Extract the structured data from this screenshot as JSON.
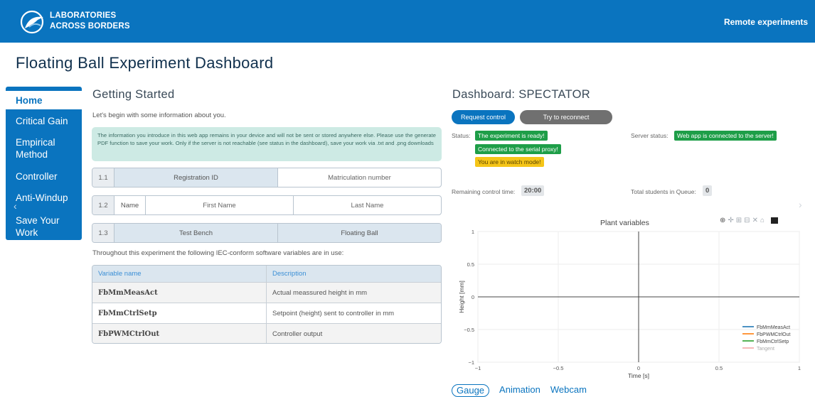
{
  "header": {
    "logo_line1": "LABORATORIES",
    "logo_line2": "ACROSS BORDERS",
    "right_link": "Remote experiments",
    "brand_color": "#0a74bf"
  },
  "page_title": "Floating Ball Experiment Dashboard",
  "sidebar": {
    "items": [
      {
        "label": "Home",
        "active": true
      },
      {
        "label": "Critical Gain"
      },
      {
        "label": "Empirical Method"
      },
      {
        "label": "Controller"
      },
      {
        "label": "Anti-Windup"
      },
      {
        "label": "Save Your Work"
      }
    ],
    "arrow_icon": "chevron-left-icon"
  },
  "getting_started": {
    "title": "Getting Started",
    "intro": "Let's begin with some information about you.",
    "info": "The information you introduce in this web app remains in your device and will not be sent or stored anywhere else. Please use the generate PDF function to save your work. Only if the server is not reachable (see status in the dashboard), save your work via .txt and .png downloads",
    "rows": [
      {
        "num": "1.1",
        "label": "Registration ID",
        "placeholder": "Matriculation number"
      },
      {
        "num": "1.2",
        "label": "Name",
        "first_placeholder": "First Name",
        "last_placeholder": "Last Name"
      },
      {
        "num": "1.3",
        "label": "Test Bench",
        "value": "Floating Ball"
      }
    ],
    "variables_intro": "Throughout this experiment the following IEC-conform software variables are in use:",
    "table": {
      "headers": [
        "Variable name",
        "Description"
      ],
      "rows": [
        [
          "FbMmMeasAct",
          "Actual meassured height in mm"
        ],
        [
          "FbMmCtrlSetp",
          "Setpoint (height) sent to controller in mm"
        ],
        [
          "FbPWMCtrlOut",
          "Controller output"
        ]
      ]
    }
  },
  "dashboard": {
    "title": "Dashboard: SPECTATOR",
    "request_btn": "Request control",
    "reconnect_btn": "Try to reconnect",
    "status_label": "Status:",
    "status_badges": [
      "The experiment is ready!",
      "Connected to the serial proxy!",
      "You are in watch mode!"
    ],
    "server_label": "Server status:",
    "server_badge": "Web app is connected to the server!",
    "remaining_label": "Remaining control time:",
    "remaining_value": "20:00",
    "queue_label": "Total students in Queue:",
    "queue_value": "0"
  },
  "chart_data": {
    "type": "line",
    "title": "Plant variables",
    "xlabel": "Time [s]",
    "ylabel": "Height [mm]",
    "xlim": [
      -1,
      1
    ],
    "ylim": [
      -1,
      1
    ],
    "xticks": [
      "−1",
      "−0.5",
      "0",
      "0.5",
      "1"
    ],
    "yticks": [
      "1",
      "0.5",
      "0",
      "−0.5",
      "−1"
    ],
    "grid": true,
    "legend_position": "bottom-right",
    "series": [
      {
        "name": "FbMmMeasAct",
        "color": "#1f77b4",
        "values": []
      },
      {
        "name": "FbPWMCtrlOut",
        "color": "#ff7f0e",
        "values": []
      },
      {
        "name": "FbMmCtrlSetp",
        "color": "#2ca02c",
        "values": []
      },
      {
        "name": "Tangent",
        "color": "#f4a6a6",
        "values": []
      }
    ]
  },
  "tabs": [
    "Gauge",
    "Animation",
    "Webcam"
  ]
}
